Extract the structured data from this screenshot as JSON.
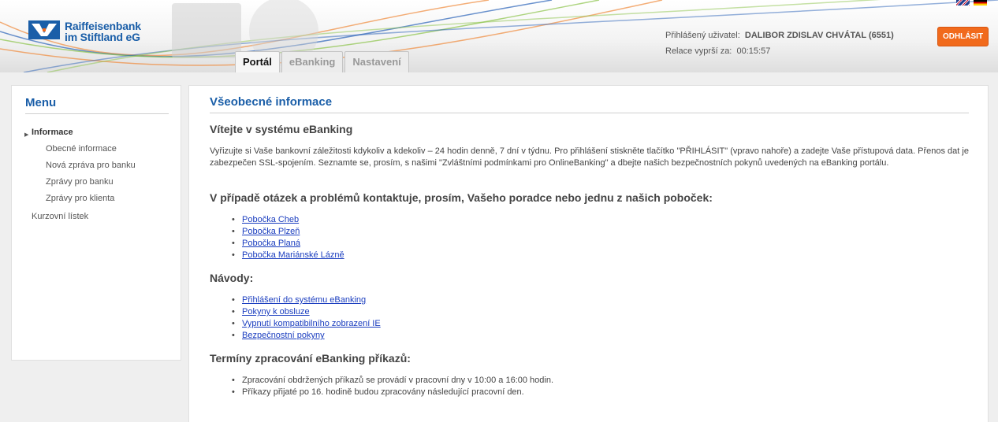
{
  "header": {
    "bank_name_line1": "Raiffeisenbank",
    "bank_name_line2": "im Stiftland eG",
    "user_label": "Přihlášený uživatel:",
    "user_name": "DALIBOR ZDISLAV CHVÁTAL (6551)",
    "session_label": "Relace vyprší za:",
    "session_time": "00:15:57",
    "logout_label": "ODHLÁSIT",
    "languages": [
      "en",
      "de"
    ]
  },
  "tabs": [
    {
      "label": "Portál",
      "active": true
    },
    {
      "label": "eBanking",
      "active": false
    },
    {
      "label": "Nastavení",
      "active": false
    }
  ],
  "sidebar": {
    "title": "Menu",
    "items": [
      {
        "label": "Informace",
        "active": true
      },
      {
        "label": "Obecné informace"
      },
      {
        "label": "Nová zpráva pro banku"
      },
      {
        "label": "Zprávy pro banku"
      },
      {
        "label": "Zprávy pro klienta"
      },
      {
        "label": "Kurzovní lístek"
      }
    ]
  },
  "main": {
    "title": "Všeobecné informace",
    "welcome_heading": "Vítejte v systému eBanking",
    "intro": "Vyřizujte si Vaše bankovní záležitosti kdykoliv a kdekoliv – 24 hodin denně, 7 dní v týdnu. Pro přihlášení stiskněte tlačítko \"PŘIHLÁSIT\" (vpravo nahoře) a zadejte Vaše přístupová data. Přenos dat je zabezpečen SSL-spojením. Seznamte se, prosím, s našimi \"Zvláštními podmínkami pro OnlineBanking\" a dbejte našich bezpečnostních pokynů uvedených na eBanking portálu.",
    "contact_heading": "V případě otázek a problémů kontaktuje, prosím, Vašeho poradce nebo jednu z našich poboček:",
    "branches": [
      "Pobočka Cheb",
      "Pobočka Plzeň",
      "Pobočka Planá",
      "Pobočka Mariánské Lázně"
    ],
    "guides_heading": "Návody:",
    "guides": [
      "Přihlášení do systému eBanking",
      "Pokyny k obsluze",
      "Vypnutí kompatibilního zobrazení IE",
      "Bezpečnostní pokyny"
    ],
    "terms_heading": "Termíny zpracování eBanking příkazů:",
    "terms": [
      "Zpracování obdržených příkazů se provádí v pracovní dny v 10:00 a 16:00 hodin.",
      "Příkazy přijaté po 16. hodině budou zpracovány následující pracovní den."
    ]
  },
  "colors": {
    "brand_blue": "#1a5ea8",
    "logout_orange": "#f16a1c",
    "link_blue": "#1a3dbf"
  }
}
